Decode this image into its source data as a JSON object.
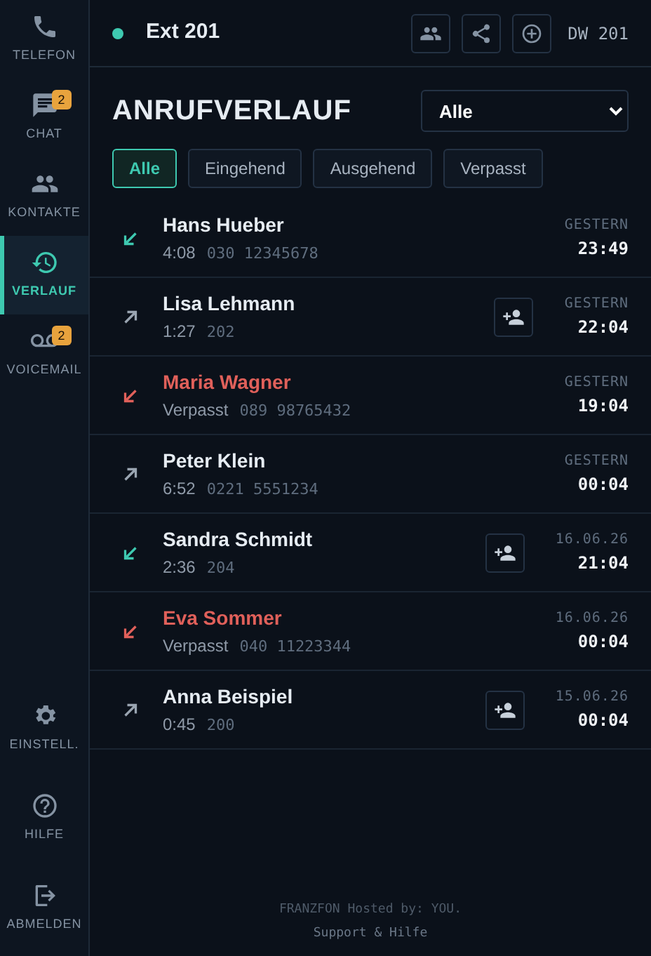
{
  "sidebar": {
    "top": [
      {
        "kind": "phone",
        "label": "TELEFON",
        "selected": false
      },
      {
        "kind": "chat",
        "label": "CHAT",
        "selected": false,
        "badge": "2"
      },
      {
        "kind": "contacts",
        "label": "KONTAKTE",
        "selected": false
      },
      {
        "kind": "history",
        "label": "VERLAUF",
        "selected": true
      },
      {
        "kind": "voicemail",
        "label": "VOICEMAIL",
        "selected": false,
        "badge": "2"
      }
    ],
    "bottom": [
      {
        "kind": "settings",
        "label": "EINSTELL.",
        "selected": false
      },
      {
        "kind": "help",
        "label": "HILFE",
        "selected": false
      },
      {
        "kind": "logout",
        "label": "ABMELDEN",
        "selected": false
      }
    ]
  },
  "header": {
    "online": true,
    "extension": "Ext 201",
    "direct_dial": "DW 201"
  },
  "title": "ANRUFVERLAUF",
  "filter_select": {
    "value": "Alle"
  },
  "filters": [
    {
      "label": "Alle",
      "selected": true
    },
    {
      "label": "Eingehend",
      "selected": false
    },
    {
      "label": "Ausgehend",
      "selected": false
    },
    {
      "label": "Verpasst",
      "selected": false
    }
  ],
  "calls": [
    {
      "kind": "incoming",
      "name": "Hans Hueber",
      "duration": "4:08",
      "number": "030 12345678",
      "add_contact": false,
      "date": "GESTERN",
      "time": "23:49"
    },
    {
      "kind": "outgoing",
      "name": "Lisa Lehmann",
      "duration": "1:27",
      "number": "202",
      "add_contact": true,
      "date": "GESTERN",
      "time": "22:04"
    },
    {
      "kind": "missed",
      "name": "Maria Wagner",
      "duration": "Verpasst",
      "number": "089 98765432",
      "add_contact": false,
      "date": "GESTERN",
      "time": "19:04"
    },
    {
      "kind": "outgoing",
      "name": "Peter Klein",
      "duration": "6:52",
      "number": "0221 5551234",
      "add_contact": false,
      "date": "GESTERN",
      "time": "00:04"
    },
    {
      "kind": "incoming",
      "name": "Sandra Schmidt",
      "duration": "2:36",
      "number": "204",
      "add_contact": true,
      "date": "16.06.26",
      "time": "21:04"
    },
    {
      "kind": "missed",
      "name": "Eva Sommer",
      "duration": "Verpasst",
      "number": "040 11223344",
      "add_contact": false,
      "date": "16.06.26",
      "time": "00:04"
    },
    {
      "kind": "outgoing",
      "name": "Anna Beispiel",
      "duration": "0:45",
      "number": "200",
      "add_contact": true,
      "date": "15.06.26",
      "time": "00:04"
    }
  ],
  "footer": {
    "text": "FRANZFON Hosted by: YOU.",
    "link": "Support & Hilfe"
  }
}
